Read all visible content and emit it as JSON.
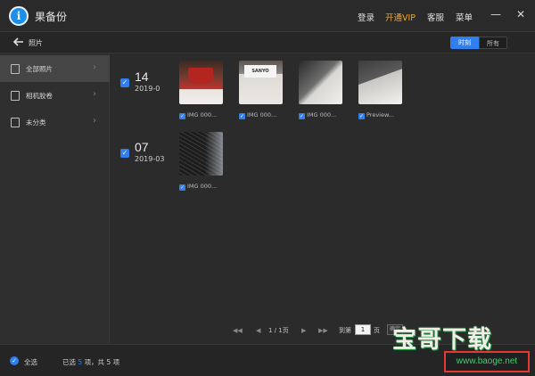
{
  "titlebar": {
    "app_title": "果备份",
    "menu": {
      "login": "登录",
      "vip": "开通VIP",
      "service": "客服",
      "menu": "菜单"
    },
    "minimize": "—",
    "close": "✕"
  },
  "subheader": {
    "title": "照片",
    "view_toggle": {
      "time": "时刻",
      "all": "所有"
    }
  },
  "sidebar": {
    "items": [
      {
        "label": "全部照片",
        "icon": "document-icon"
      },
      {
        "label": "相机胶卷",
        "icon": "image-icon"
      },
      {
        "label": "未分类",
        "icon": "image-icon"
      }
    ]
  },
  "groups": [
    {
      "day": "14",
      "month": "2019-0",
      "photos": [
        {
          "caption": "IMG 000..."
        },
        {
          "caption": "IMG 000..."
        },
        {
          "caption": "IMG 000..."
        },
        {
          "caption": "Preview..."
        }
      ]
    },
    {
      "day": "07",
      "month": "2019-03",
      "photos": [
        {
          "caption": "IMG 000..."
        }
      ]
    }
  ],
  "pagination": {
    "page_status": "1 / 1页",
    "goto_label": "到第",
    "page_value": "1",
    "page_unit": "页",
    "go": "确定"
  },
  "footer": {
    "select_all": "全选",
    "selected_prefix": "已选",
    "selected_count": "5",
    "selected_mid": "项，共",
    "total_count": "5",
    "selected_suffix": "项"
  },
  "watermark": {
    "title": "宝哥下载",
    "url": "www.baoge.net"
  },
  "colors": {
    "accent": "#2f7ff0",
    "vip": "#f5a623",
    "background": "#2b2b2b"
  }
}
